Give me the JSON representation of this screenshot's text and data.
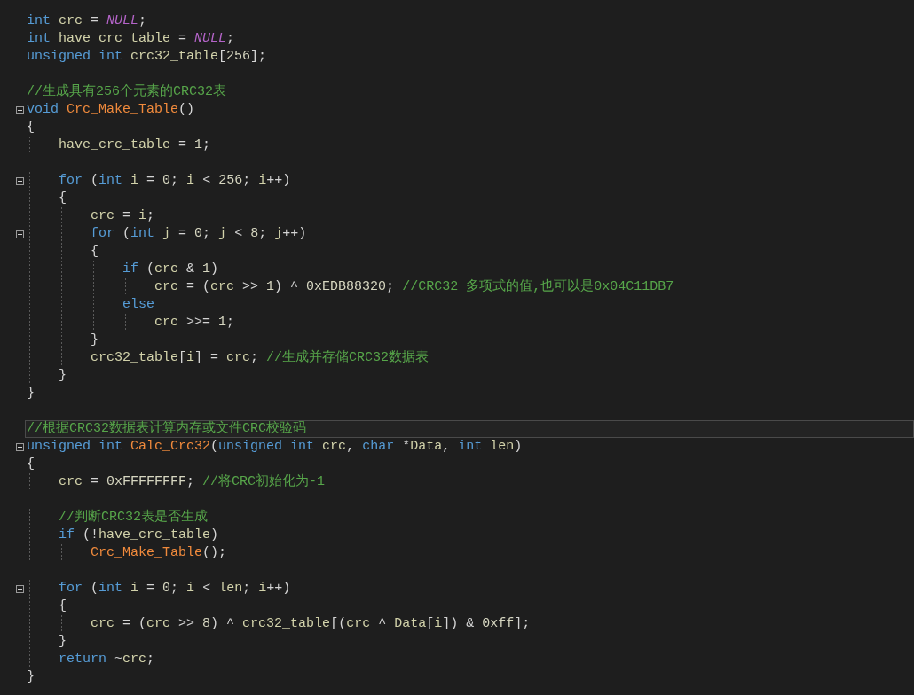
{
  "editor": {
    "lines": [
      {
        "kind": "code",
        "fold": false,
        "current": false,
        "tokens": [
          {
            "kind": "keyword",
            "text": "int"
          },
          {
            "kind": "name",
            "text": " crc"
          },
          {
            "kind": "symbol",
            "text": " = "
          },
          {
            "kind": "macro",
            "text": "NULL"
          },
          {
            "kind": "symbol",
            "text": ";"
          }
        ]
      },
      {
        "kind": "code",
        "fold": false,
        "current": false,
        "tokens": [
          {
            "kind": "keyword",
            "text": "int"
          },
          {
            "kind": "name",
            "text": " have_crc_table"
          },
          {
            "kind": "symbol",
            "text": " = "
          },
          {
            "kind": "macro",
            "text": "NULL"
          },
          {
            "kind": "symbol",
            "text": ";"
          }
        ]
      },
      {
        "kind": "code",
        "fold": false,
        "current": false,
        "tokens": [
          {
            "kind": "keyword",
            "text": "unsigned int"
          },
          {
            "kind": "name",
            "text": " crc32_table"
          },
          {
            "kind": "symbol",
            "text": "["
          },
          {
            "kind": "number",
            "text": "256"
          },
          {
            "kind": "symbol",
            "text": "];"
          }
        ]
      },
      {
        "kind": "blank"
      },
      {
        "kind": "code",
        "fold": false,
        "current": false,
        "tokens": [
          {
            "kind": "comment",
            "text": "//生成具有256个元素的CRC32表"
          }
        ]
      },
      {
        "kind": "code",
        "fold": true,
        "current": false,
        "tokens": [
          {
            "kind": "keyword",
            "text": "void"
          },
          {
            "kind": "function",
            "text": " Crc_Make_Table"
          },
          {
            "kind": "symbol",
            "text": "()"
          }
        ]
      },
      {
        "kind": "code",
        "fold": false,
        "current": false,
        "tokens": [
          {
            "kind": "symbol",
            "text": "{"
          }
        ]
      },
      {
        "kind": "code",
        "fold": false,
        "current": false,
        "tokens": [
          {
            "kind": "name",
            "text": "    have_crc_table"
          },
          {
            "kind": "symbol",
            "text": " = "
          },
          {
            "kind": "number",
            "text": "1"
          },
          {
            "kind": "symbol",
            "text": ";"
          }
        ]
      },
      {
        "kind": "blank"
      },
      {
        "kind": "code",
        "fold": true,
        "current": false,
        "tokens": [
          {
            "kind": "keyword",
            "text": "    for"
          },
          {
            "kind": "symbol",
            "text": " ("
          },
          {
            "kind": "keyword",
            "text": "int"
          },
          {
            "kind": "name",
            "text": " i"
          },
          {
            "kind": "symbol",
            "text": " = "
          },
          {
            "kind": "number",
            "text": "0"
          },
          {
            "kind": "symbol",
            "text": "; "
          },
          {
            "kind": "name",
            "text": "i"
          },
          {
            "kind": "symbol",
            "text": " < "
          },
          {
            "kind": "number",
            "text": "256"
          },
          {
            "kind": "symbol",
            "text": "; "
          },
          {
            "kind": "name",
            "text": "i"
          },
          {
            "kind": "symbol",
            "text": "++)"
          }
        ]
      },
      {
        "kind": "code",
        "fold": false,
        "current": false,
        "tokens": [
          {
            "kind": "symbol",
            "text": "    {"
          }
        ]
      },
      {
        "kind": "code",
        "fold": false,
        "current": false,
        "tokens": [
          {
            "kind": "name",
            "text": "        crc"
          },
          {
            "kind": "symbol",
            "text": " = "
          },
          {
            "kind": "name",
            "text": "i"
          },
          {
            "kind": "symbol",
            "text": ";"
          }
        ]
      },
      {
        "kind": "code",
        "fold": true,
        "current": false,
        "tokens": [
          {
            "kind": "keyword",
            "text": "        for"
          },
          {
            "kind": "symbol",
            "text": " ("
          },
          {
            "kind": "keyword",
            "text": "int"
          },
          {
            "kind": "name",
            "text": " j"
          },
          {
            "kind": "symbol",
            "text": " = "
          },
          {
            "kind": "number",
            "text": "0"
          },
          {
            "kind": "symbol",
            "text": "; "
          },
          {
            "kind": "name",
            "text": "j"
          },
          {
            "kind": "symbol",
            "text": " < "
          },
          {
            "kind": "number",
            "text": "8"
          },
          {
            "kind": "symbol",
            "text": "; "
          },
          {
            "kind": "name",
            "text": "j"
          },
          {
            "kind": "symbol",
            "text": "++)"
          }
        ]
      },
      {
        "kind": "code",
        "fold": false,
        "current": false,
        "tokens": [
          {
            "kind": "symbol",
            "text": "        {"
          }
        ]
      },
      {
        "kind": "code",
        "fold": false,
        "current": false,
        "tokens": [
          {
            "kind": "keyword",
            "text": "            if"
          },
          {
            "kind": "symbol",
            "text": " ("
          },
          {
            "kind": "name",
            "text": "crc"
          },
          {
            "kind": "symbol",
            "text": " & "
          },
          {
            "kind": "number",
            "text": "1"
          },
          {
            "kind": "symbol",
            "text": ")"
          }
        ]
      },
      {
        "kind": "code",
        "fold": false,
        "current": false,
        "tokens": [
          {
            "kind": "name",
            "text": "                crc"
          },
          {
            "kind": "symbol",
            "text": " = ("
          },
          {
            "kind": "name",
            "text": "crc"
          },
          {
            "kind": "symbol",
            "text": " >> "
          },
          {
            "kind": "number",
            "text": "1"
          },
          {
            "kind": "symbol",
            "text": ") ^ "
          },
          {
            "kind": "number",
            "text": "0xEDB88320"
          },
          {
            "kind": "symbol",
            "text": "; "
          },
          {
            "kind": "comment",
            "text": "//CRC32 多项式的值,也可以是0x04C11DB7"
          }
        ]
      },
      {
        "kind": "code",
        "fold": false,
        "current": false,
        "tokens": [
          {
            "kind": "keyword",
            "text": "            else"
          }
        ]
      },
      {
        "kind": "code",
        "fold": false,
        "current": false,
        "tokens": [
          {
            "kind": "name",
            "text": "                crc"
          },
          {
            "kind": "symbol",
            "text": " >>= "
          },
          {
            "kind": "number",
            "text": "1"
          },
          {
            "kind": "symbol",
            "text": ";"
          }
        ]
      },
      {
        "kind": "code",
        "fold": false,
        "current": false,
        "tokens": [
          {
            "kind": "symbol",
            "text": "        }"
          }
        ]
      },
      {
        "kind": "code",
        "fold": false,
        "current": false,
        "tokens": [
          {
            "kind": "name",
            "text": "        crc32_table"
          },
          {
            "kind": "symbol",
            "text": "["
          },
          {
            "kind": "name",
            "text": "i"
          },
          {
            "kind": "symbol",
            "text": "] = "
          },
          {
            "kind": "name",
            "text": "crc"
          },
          {
            "kind": "symbol",
            "text": "; "
          },
          {
            "kind": "comment",
            "text": "//生成并存储CRC32数据表"
          }
        ]
      },
      {
        "kind": "code",
        "fold": false,
        "current": false,
        "tokens": [
          {
            "kind": "symbol",
            "text": "    }"
          }
        ]
      },
      {
        "kind": "code",
        "fold": false,
        "current": false,
        "tokens": [
          {
            "kind": "symbol",
            "text": "}"
          }
        ]
      },
      {
        "kind": "blank"
      },
      {
        "kind": "code",
        "fold": false,
        "current": true,
        "tokens": [
          {
            "kind": "comment",
            "text": "//根据CRC32数据表计算内存或文件CRC校验码"
          }
        ]
      },
      {
        "kind": "code",
        "fold": true,
        "current": false,
        "tokens": [
          {
            "kind": "keyword",
            "text": "unsigned int"
          },
          {
            "kind": "function",
            "text": " Calc_Crc32"
          },
          {
            "kind": "symbol",
            "text": "("
          },
          {
            "kind": "keyword",
            "text": "unsigned int"
          },
          {
            "kind": "name",
            "text": " crc"
          },
          {
            "kind": "symbol",
            "text": ", "
          },
          {
            "kind": "keyword",
            "text": "char"
          },
          {
            "kind": "symbol",
            "text": " *"
          },
          {
            "kind": "name",
            "text": "Data"
          },
          {
            "kind": "symbol",
            "text": ", "
          },
          {
            "kind": "keyword",
            "text": "int"
          },
          {
            "kind": "name",
            "text": " len"
          },
          {
            "kind": "symbol",
            "text": ")"
          }
        ]
      },
      {
        "kind": "code",
        "fold": false,
        "current": false,
        "tokens": [
          {
            "kind": "symbol",
            "text": "{"
          }
        ]
      },
      {
        "kind": "code",
        "fold": false,
        "current": false,
        "tokens": [
          {
            "kind": "name",
            "text": "    crc"
          },
          {
            "kind": "symbol",
            "text": " = "
          },
          {
            "kind": "number",
            "text": "0xFFFFFFFF"
          },
          {
            "kind": "symbol",
            "text": "; "
          },
          {
            "kind": "comment",
            "text": "//将CRC初始化为-1"
          }
        ]
      },
      {
        "kind": "blank"
      },
      {
        "kind": "code",
        "fold": false,
        "current": false,
        "tokens": [
          {
            "kind": "comment",
            "text": "    //判断CRC32表是否生成"
          }
        ]
      },
      {
        "kind": "code",
        "fold": false,
        "current": false,
        "tokens": [
          {
            "kind": "keyword",
            "text": "    if"
          },
          {
            "kind": "symbol",
            "text": " (!"
          },
          {
            "kind": "name",
            "text": "have_crc_table"
          },
          {
            "kind": "symbol",
            "text": ")"
          }
        ]
      },
      {
        "kind": "code",
        "fold": false,
        "current": false,
        "tokens": [
          {
            "kind": "function",
            "text": "        Crc_Make_Table"
          },
          {
            "kind": "symbol",
            "text": "();"
          }
        ]
      },
      {
        "kind": "blank"
      },
      {
        "kind": "code",
        "fold": true,
        "current": false,
        "tokens": [
          {
            "kind": "keyword",
            "text": "    for"
          },
          {
            "kind": "symbol",
            "text": " ("
          },
          {
            "kind": "keyword",
            "text": "int"
          },
          {
            "kind": "name",
            "text": " i"
          },
          {
            "kind": "symbol",
            "text": " = "
          },
          {
            "kind": "number",
            "text": "0"
          },
          {
            "kind": "symbol",
            "text": "; "
          },
          {
            "kind": "name",
            "text": "i"
          },
          {
            "kind": "symbol",
            "text": " < "
          },
          {
            "kind": "name",
            "text": "len"
          },
          {
            "kind": "symbol",
            "text": "; "
          },
          {
            "kind": "name",
            "text": "i"
          },
          {
            "kind": "symbol",
            "text": "++)"
          }
        ]
      },
      {
        "kind": "code",
        "fold": false,
        "current": false,
        "tokens": [
          {
            "kind": "symbol",
            "text": "    {"
          }
        ]
      },
      {
        "kind": "code",
        "fold": false,
        "current": false,
        "tokens": [
          {
            "kind": "name",
            "text": "        crc"
          },
          {
            "kind": "symbol",
            "text": " = ("
          },
          {
            "kind": "name",
            "text": "crc"
          },
          {
            "kind": "symbol",
            "text": " >> "
          },
          {
            "kind": "number",
            "text": "8"
          },
          {
            "kind": "symbol",
            "text": ") ^ "
          },
          {
            "kind": "name",
            "text": "crc32_table"
          },
          {
            "kind": "symbol",
            "text": "[("
          },
          {
            "kind": "name",
            "text": "crc"
          },
          {
            "kind": "symbol",
            "text": " ^ "
          },
          {
            "kind": "name",
            "text": "Data"
          },
          {
            "kind": "symbol",
            "text": "["
          },
          {
            "kind": "name",
            "text": "i"
          },
          {
            "kind": "symbol",
            "text": "]) & "
          },
          {
            "kind": "number",
            "text": "0xff"
          },
          {
            "kind": "symbol",
            "text": "];"
          }
        ]
      },
      {
        "kind": "code",
        "fold": false,
        "current": false,
        "tokens": [
          {
            "kind": "symbol",
            "text": "    }"
          }
        ]
      },
      {
        "kind": "code",
        "fold": false,
        "current": false,
        "tokens": [
          {
            "kind": "keyword",
            "text": "    return"
          },
          {
            "kind": "symbol",
            "text": " ~"
          },
          {
            "kind": "name",
            "text": "crc"
          },
          {
            "kind": "symbol",
            "text": ";"
          }
        ]
      },
      {
        "kind": "code",
        "fold": false,
        "current": false,
        "tokens": [
          {
            "kind": "symbol",
            "text": "}"
          }
        ]
      }
    ]
  }
}
